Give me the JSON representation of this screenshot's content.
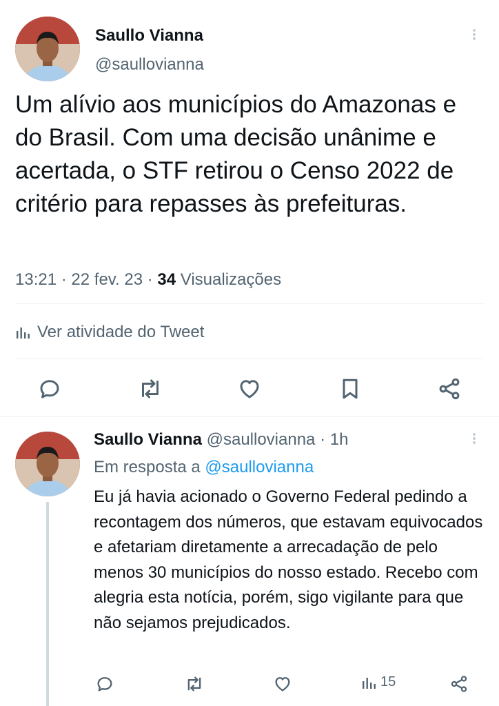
{
  "main_tweet": {
    "author_name": "Saullo Vianna",
    "author_handle": "@saullovianna",
    "text": "Um alívio aos municípios do Amazonas e do Brasil. Com uma decisão unânime e acertada, o STF retirou o Censo 2022 de critério para repasses às prefeituras.",
    "time": "13:21",
    "sep1": "·",
    "date": "22 fev. 23",
    "sep2": "·",
    "views_count": "34",
    "views_label": "Visualizações",
    "activity_label": "Ver atividade do Tweet",
    "actions": [
      "reply-icon",
      "retweet-icon",
      "like-icon",
      "bookmark-icon",
      "share-icon"
    ]
  },
  "reply_tweet": {
    "author_name": "Saullo Vianna",
    "author_handle": "@saullovianna",
    "sep": "·",
    "age": "1h",
    "reply_prefix": "Em resposta a",
    "reply_to": "@saullovianna",
    "text": "Eu já havia acionado o Governo Federal pedindo a recontagem dos números, que estavam equivocados e afetariam diretamente a arrecadação de pelo menos 30 municípios do nosso estado. Recebo com alegria esta notícia, porém, sigo vigilante para que não sejamos prejudicados.",
    "views_count": "15",
    "actions": [
      "reply-icon",
      "retweet-icon",
      "like-icon",
      "views-icon",
      "share-icon"
    ]
  },
  "colors": {
    "text": "#0f1419",
    "secondary": "#536471",
    "link": "#1d9bf0",
    "divider": "#eff3f4"
  }
}
